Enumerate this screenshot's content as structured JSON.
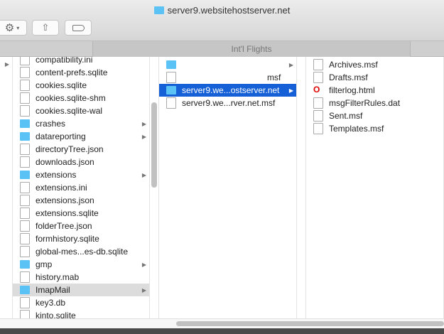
{
  "window": {
    "title": "server9.websitehostserver.net"
  },
  "tab": {
    "label": "Int'l Flights"
  },
  "col1": [
    {
      "name": "compatibility.ini",
      "type": "file"
    },
    {
      "name": "content-prefs.sqlite",
      "type": "file"
    },
    {
      "name": "cookies.sqlite",
      "type": "file"
    },
    {
      "name": "cookies.sqlite-shm",
      "type": "file"
    },
    {
      "name": "cookies.sqlite-wal",
      "type": "file"
    },
    {
      "name": "crashes",
      "type": "folder"
    },
    {
      "name": "datareporting",
      "type": "folder"
    },
    {
      "name": "directoryTree.json",
      "type": "file"
    },
    {
      "name": "downloads.json",
      "type": "file"
    },
    {
      "name": "extensions",
      "type": "folder"
    },
    {
      "name": "extensions.ini",
      "type": "file"
    },
    {
      "name": "extensions.json",
      "type": "file"
    },
    {
      "name": "extensions.sqlite",
      "type": "file"
    },
    {
      "name": "folderTree.json",
      "type": "file"
    },
    {
      "name": "formhistory.sqlite",
      "type": "file"
    },
    {
      "name": "global-mes...es-db.sqlite",
      "type": "file"
    },
    {
      "name": "gmp",
      "type": "folder"
    },
    {
      "name": "history.mab",
      "type": "file"
    },
    {
      "name": "ImapMail",
      "type": "folder",
      "state": "path"
    },
    {
      "name": "key3.db",
      "type": "file"
    },
    {
      "name": "kinto.sqlite",
      "type": "file"
    }
  ],
  "col2": [
    {
      "name": "",
      "type": "folder"
    },
    {
      "name": "msf",
      "type": "file"
    },
    {
      "name": "server9.we...ostserver.net",
      "type": "folder",
      "state": "selected"
    },
    {
      "name": "server9.we...rver.net.msf",
      "type": "file"
    }
  ],
  "col3": [
    {
      "name": "Archives.msf",
      "type": "file"
    },
    {
      "name": "Drafts.msf",
      "type": "file"
    },
    {
      "name": "filterlog.html",
      "type": "html"
    },
    {
      "name": "msgFilterRules.dat",
      "type": "file"
    },
    {
      "name": "Sent.msf",
      "type": "file"
    },
    {
      "name": "Templates.msf",
      "type": "file"
    }
  ]
}
